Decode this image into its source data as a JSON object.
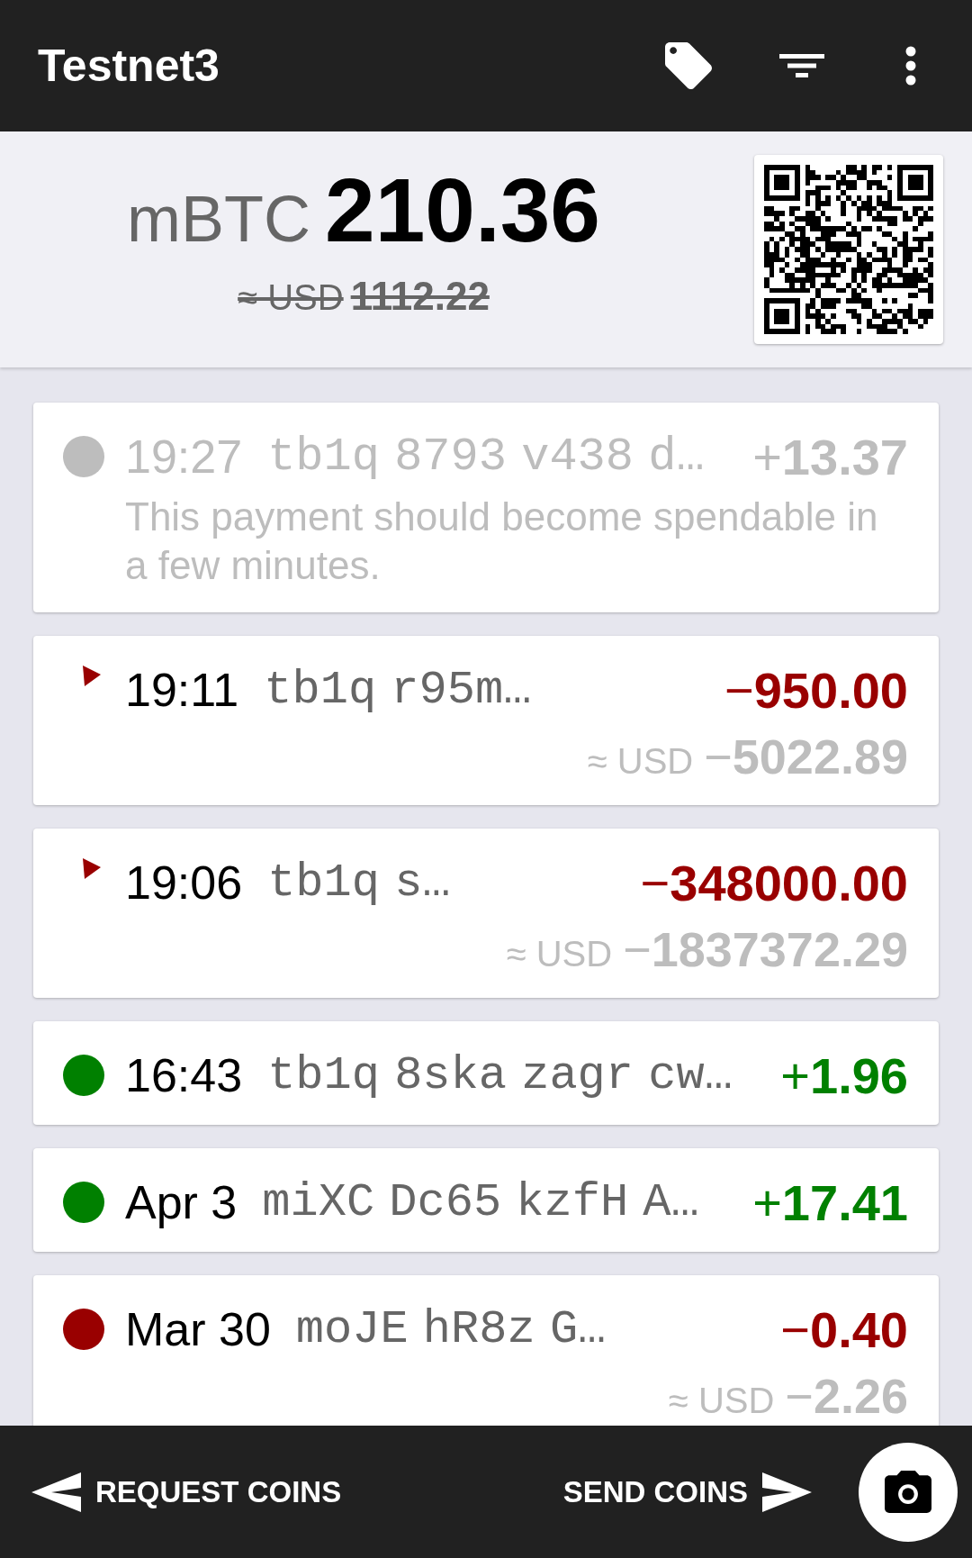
{
  "app_bar": {
    "title": "Testnet3"
  },
  "balance": {
    "currency": "mBTC",
    "amount": "210.36",
    "fiat_prefix": "≈ USD",
    "fiat_amount": "1112.22",
    "fiat_struck": true
  },
  "transactions": [
    {
      "kind": "dot",
      "color": "#bdbdbd",
      "pending": true,
      "time": "19:27",
      "address": "tb1q 8793 v438 d…",
      "amount": "+**13.37**",
      "message": "This payment should become spendable in a few minutes."
    },
    {
      "kind": "flag",
      "color": "#990000",
      "pending": false,
      "sent": true,
      "time": "19:11",
      "address": "tb1q r95m…",
      "amount": "−**950.00**",
      "fiat": {
        "prefix": "≈ USD",
        "amount": "−**5022.89**"
      }
    },
    {
      "kind": "flag",
      "color": "#990000",
      "pending": false,
      "sent": true,
      "time": "19:06",
      "address": "tb1q s…",
      "amount": "−**348000.00**",
      "fiat": {
        "prefix": "≈ USD",
        "amount": "−**1837372.29**"
      }
    },
    {
      "kind": "dot",
      "color": "#008000",
      "pending": false,
      "sent": false,
      "time": "16:43",
      "address": "tb1q 8ska zagr cw…",
      "amount": "+**1.96**"
    },
    {
      "kind": "dot",
      "color": "#008000",
      "pending": false,
      "sent": false,
      "time": "Apr 3",
      "address": "miXC Dc65 kzfH A…",
      "amount": "+**17.41**"
    },
    {
      "kind": "dot",
      "color": "#990000",
      "pending": false,
      "sent": true,
      "time": "Mar 30",
      "address": "moJE hR8z G…",
      "amount": "−**0.40**",
      "fiat": {
        "prefix": "≈ USD",
        "amount": "−**2.26**"
      }
    }
  ],
  "bottom_bar": {
    "request_button": "REQUEST COINS",
    "send_button": "SEND COINS"
  }
}
